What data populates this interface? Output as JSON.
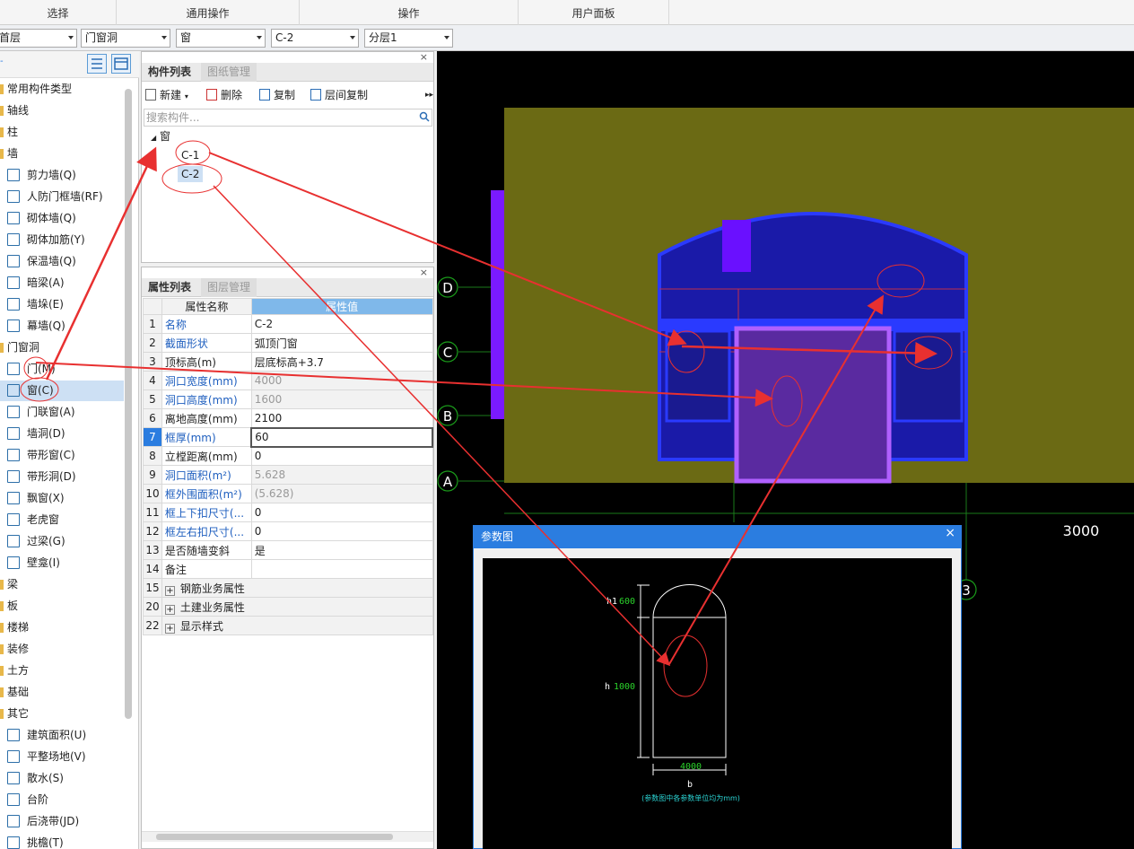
{
  "ribbon": {
    "groups": [
      "选择",
      "通用操作",
      "操作",
      "用户面板"
    ]
  },
  "filterbar": {
    "combos": [
      "首层",
      "门窗洞",
      "窗",
      "C-2",
      "分层1"
    ]
  },
  "leftnav": {
    "items": [
      {
        "label": "常用构件类型",
        "kind": "cat"
      },
      {
        "label": "轴线",
        "kind": "cat"
      },
      {
        "label": "柱",
        "kind": "cat"
      },
      {
        "label": "墙",
        "kind": "cat"
      },
      {
        "label": "剪力墙(Q)",
        "kind": "sub"
      },
      {
        "label": "人防门框墙(RF)",
        "kind": "sub"
      },
      {
        "label": "砌体墙(Q)",
        "kind": "sub"
      },
      {
        "label": "砌体加筋(Y)",
        "kind": "sub"
      },
      {
        "label": "保温墙(Q)",
        "kind": "sub"
      },
      {
        "label": "暗梁(A)",
        "kind": "sub"
      },
      {
        "label": "墙垛(E)",
        "kind": "sub"
      },
      {
        "label": "幕墙(Q)",
        "kind": "sub"
      },
      {
        "label": "门窗洞",
        "kind": "cat"
      },
      {
        "label": "门(M)",
        "kind": "sub"
      },
      {
        "label": "窗(C)",
        "kind": "sub",
        "selected": true
      },
      {
        "label": "门联窗(A)",
        "kind": "sub"
      },
      {
        "label": "墙洞(D)",
        "kind": "sub"
      },
      {
        "label": "带形窗(C)",
        "kind": "sub"
      },
      {
        "label": "带形洞(D)",
        "kind": "sub"
      },
      {
        "label": "飘窗(X)",
        "kind": "sub"
      },
      {
        "label": "老虎窗",
        "kind": "sub"
      },
      {
        "label": "过梁(G)",
        "kind": "sub"
      },
      {
        "label": "壁龛(I)",
        "kind": "sub"
      },
      {
        "label": "梁",
        "kind": "cat"
      },
      {
        "label": "板",
        "kind": "cat"
      },
      {
        "label": "楼梯",
        "kind": "cat"
      },
      {
        "label": "装修",
        "kind": "cat"
      },
      {
        "label": "土方",
        "kind": "cat"
      },
      {
        "label": "基础",
        "kind": "cat"
      },
      {
        "label": "其它",
        "kind": "cat"
      },
      {
        "label": "建筑面积(U)",
        "kind": "sub"
      },
      {
        "label": "平整场地(V)",
        "kind": "sub"
      },
      {
        "label": "散水(S)",
        "kind": "sub"
      },
      {
        "label": "台阶",
        "kind": "sub"
      },
      {
        "label": "后浇带(JD)",
        "kind": "sub"
      },
      {
        "label": "挑檐(T)",
        "kind": "sub"
      }
    ]
  },
  "component_panel": {
    "tab_active": "构件列表",
    "tab_inactive": "图纸管理",
    "toolbar": {
      "new": "新建",
      "delete": "删除",
      "copy": "复制",
      "floor_copy": "层间复制"
    },
    "search_placeholder": "搜索构件...",
    "tree": {
      "root": "窗",
      "children": [
        "C-1",
        "C-2"
      ]
    }
  },
  "property_panel": {
    "tab_active": "属性列表",
    "tab_inactive": "图层管理",
    "header": {
      "name": "属性名称",
      "value": "属性值"
    },
    "rows": [
      {
        "num": "1",
        "name": "名称",
        "value": "C-2",
        "blue": true
      },
      {
        "num": "2",
        "name": "截面形状",
        "value": "弧顶门窗",
        "blue": true
      },
      {
        "num": "3",
        "name": "顶标高(m)",
        "value": "层底标高+3.7",
        "blue": false
      },
      {
        "num": "4",
        "name": "洞口宽度(mm)",
        "value": "4000",
        "blue": true,
        "grayval": true
      },
      {
        "num": "5",
        "name": "洞口高度(mm)",
        "value": "1600",
        "blue": true,
        "grayval": true
      },
      {
        "num": "6",
        "name": "离地高度(mm)",
        "value": "2100",
        "blue": false
      },
      {
        "num": "7",
        "name": "框厚(mm)",
        "value": "60",
        "blue": true,
        "active": true
      },
      {
        "num": "8",
        "name": "立樘距离(mm)",
        "value": "0",
        "blue": false
      },
      {
        "num": "9",
        "name": "洞口面积(m²)",
        "value": "5.628",
        "blue": true,
        "grayval": true
      },
      {
        "num": "10",
        "name": "框外围面积(m²)",
        "value": "(5.628)",
        "blue": true,
        "grayval": true
      },
      {
        "num": "11",
        "name": "框上下扣尺寸(...",
        "value": "0",
        "blue": true
      },
      {
        "num": "12",
        "name": "框左右扣尺寸(...",
        "value": "0",
        "blue": true
      },
      {
        "num": "13",
        "name": "是否随墙变斜",
        "value": "是",
        "blue": false
      },
      {
        "num": "14",
        "name": "备注",
        "value": "",
        "blue": false
      },
      {
        "num": "15",
        "name": "钢筋业务属性",
        "value": "",
        "group": true
      },
      {
        "num": "20",
        "name": "土建业务属性",
        "value": "",
        "group": true
      },
      {
        "num": "22",
        "name": "显示样式",
        "value": "",
        "group": true
      }
    ]
  },
  "canvas": {
    "axis_labels": [
      "D",
      "C",
      "B",
      "A"
    ],
    "axis_bottom": "3",
    "dimension": "3000"
  },
  "dialog": {
    "title": "参数图",
    "close": "×",
    "labels": {
      "h1": "h1",
      "h1_val": "600",
      "h": "h",
      "h_val": "1000",
      "width_val": "4000",
      "b": "b",
      "note": "(参数图中各参数单位均为mm)"
    }
  },
  "colors": {
    "accent": "#2b7de0",
    "wall": "#6b6a14",
    "window": "#1a1aa8",
    "annotation": "#e83030"
  }
}
